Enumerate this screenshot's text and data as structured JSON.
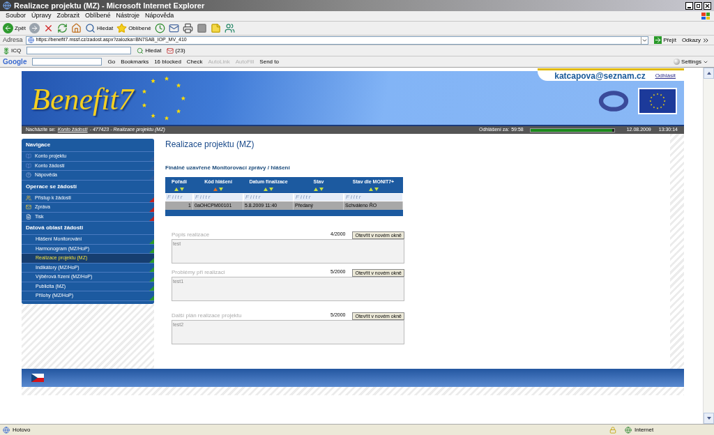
{
  "window": {
    "title": "Realizace projektu (MZ) - Microsoft Internet Explorer"
  },
  "menu": [
    "Soubor",
    "Úpravy",
    "Zobrazit",
    "Oblíbené",
    "Nástroje",
    "Nápověda"
  ],
  "toolbar": [
    {
      "kind": "back",
      "label": "Zpět"
    },
    {
      "kind": "forward"
    },
    {
      "kind": "stop"
    },
    {
      "kind": "refresh"
    },
    {
      "kind": "home"
    },
    {
      "kind": "search",
      "label": "Hledat"
    },
    {
      "kind": "favorites",
      "label": "Oblíbené"
    },
    {
      "kind": "history"
    },
    {
      "kind": "mail"
    },
    {
      "kind": "print"
    },
    {
      "kind": "edit"
    },
    {
      "kind": "note"
    },
    {
      "kind": "messenger"
    }
  ],
  "address": {
    "label": "Adresa",
    "url": "https://benefit7.mssf.cz/zadost.aspx?zalozka=BN7SAB_IOP_MV_410",
    "go": "Přejít",
    "links": "Odkazy"
  },
  "icq_bar": {
    "label": "ICQ",
    "search": "Hledat",
    "count": "(23)"
  },
  "google_bar": {
    "logo": "Google",
    "items": [
      {
        "label": "Go",
        "disabled": false
      },
      {
        "label": "Bookmarks",
        "disabled": false
      },
      {
        "label": "16 blocked",
        "disabled": false
      },
      {
        "label": "Check",
        "disabled": false
      },
      {
        "label": "AutoLink",
        "disabled": true
      },
      {
        "label": "AutoFill",
        "disabled": true
      },
      {
        "label": "Send to",
        "disabled": false
      }
    ],
    "settings": "Settings"
  },
  "page": {
    "logo": "Benefit7",
    "user": "katcapova@seznam.cz",
    "logout": "Odhlásit",
    "breadcrumb": {
      "prefix": "Nacházíte se:",
      "link": "Konto žádostí",
      "rest": "- 477423 - Realizace projektu (MZ)"
    },
    "session": {
      "label": "Odhlášení za:",
      "remaining": "59:58",
      "level": 0.98,
      "date": "12.08.2009",
      "time": "13:30:14"
    },
    "sidebar": [
      {
        "title": "Navigace",
        "kind": "navigation",
        "items": [
          {
            "label": "Konto projektu",
            "kind": "book",
            "selected": false
          },
          {
            "label": "Konto žádostí",
            "kind": "book",
            "selected": false
          },
          {
            "label": "Nápověda",
            "kind": "help",
            "selected": false
          }
        ]
      },
      {
        "title": "Operace se žádostí",
        "kind": "operations",
        "items": [
          {
            "label": "Přístup k žádosti",
            "kind": "people",
            "selected": false
          },
          {
            "label": "Zpráva",
            "kind": "mail",
            "selected": false
          },
          {
            "label": "Tisk",
            "kind": "document",
            "selected": false
          }
        ]
      },
      {
        "title": "Datová oblast žádosti",
        "kind": "data",
        "items": [
          {
            "label": "Hlášení Monitorování",
            "kind": "plain",
            "selected": false
          },
          {
            "label": "Harmonogram (MZ/HoP)",
            "kind": "plain",
            "selected": false
          },
          {
            "label": "Realizace projektu (MZ)",
            "kind": "plain",
            "selected": true
          },
          {
            "label": "Indikátory (MZ/HoP)",
            "kind": "plain",
            "selected": false
          },
          {
            "label": "Výběrová řízení (MZ/HoP)",
            "kind": "plain",
            "selected": false
          },
          {
            "label": "Publicita (MZ)",
            "kind": "plain",
            "selected": false
          },
          {
            "label": "Přílohy (MZ/HoP)",
            "kind": "plain",
            "selected": false
          }
        ]
      }
    ],
    "heading": "Realizace projektu (MZ)",
    "subheading": "Finálně uzavřené Monitorovací zprávy / hlášení",
    "table": {
      "columns": [
        {
          "label": "Pořadí",
          "sorted": false,
          "filter_placeholder": "Filtr"
        },
        {
          "label": "Kód hlášení",
          "sorted": true,
          "filter_placeholder": "Filtr"
        },
        {
          "label": "Datum finalizace",
          "sorted": false,
          "filter_placeholder": "Filtr"
        },
        {
          "label": "Stav",
          "sorted": false,
          "filter_placeholder": "Filtr"
        },
        {
          "label": "Stav dle MONIT7+",
          "sorted": false,
          "filter_placeholder": "Filtr"
        }
      ],
      "rows": [
        [
          "1",
          "0aOHCPM00101",
          "5.8.2009 11:40",
          "Předaný",
          "Schváleno ŘO"
        ]
      ]
    },
    "fields": [
      {
        "label": "Popis realizace",
        "counter": "4/2000",
        "button": "Otevřít v novém okně",
        "value": "test"
      },
      {
        "label": "Problémy při realizaci",
        "counter": "5/2000",
        "button": "Otevřít v novém okně",
        "value": "test1"
      },
      {
        "label": "Další plán realizace projektu",
        "counter": "5/2000",
        "button": "Otevřít v novém okně",
        "value": "test2"
      }
    ]
  },
  "status_bar": {
    "text": "Hotovo",
    "zone": "Internet"
  }
}
